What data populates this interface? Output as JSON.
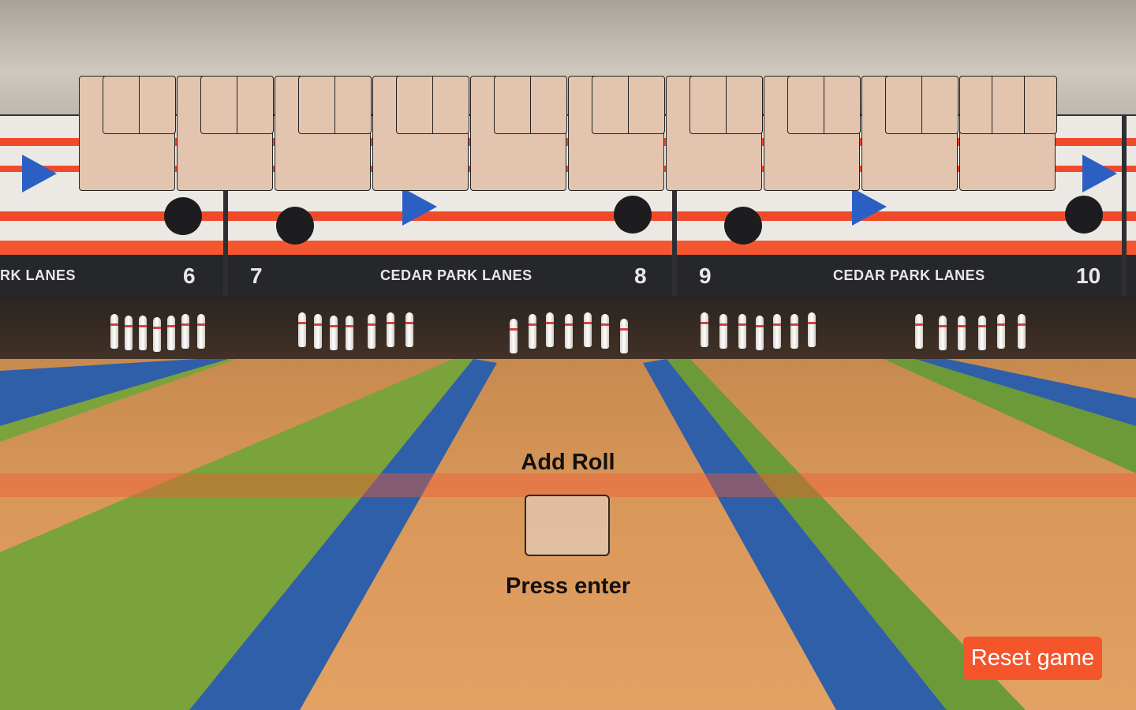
{
  "background": {
    "sign_left_partial": "RK LANES",
    "sign_center": "CEDAR PARK LANES",
    "sign_right": "CEDAR PARK LANES",
    "lane_numbers": [
      "6",
      "7",
      "8",
      "9",
      "10"
    ]
  },
  "scoreboard": {
    "frames": [
      {
        "roll1": "",
        "roll2": "",
        "score": ""
      },
      {
        "roll1": "",
        "roll2": "",
        "score": ""
      },
      {
        "roll1": "",
        "roll2": "",
        "score": ""
      },
      {
        "roll1": "",
        "roll2": "",
        "score": ""
      },
      {
        "roll1": "",
        "roll2": "",
        "score": ""
      },
      {
        "roll1": "",
        "roll2": "",
        "score": ""
      },
      {
        "roll1": "",
        "roll2": "",
        "score": ""
      },
      {
        "roll1": "",
        "roll2": "",
        "score": ""
      },
      {
        "roll1": "",
        "roll2": "",
        "score": ""
      },
      {
        "roll1": "",
        "roll2": "",
        "roll3": "",
        "score": ""
      }
    ]
  },
  "roll_entry": {
    "label": "Add Roll",
    "value": "",
    "hint": "Press enter"
  },
  "controls": {
    "reset_label": "Reset game"
  },
  "colors": {
    "frame_fill": "#e3c4ae",
    "reset_button": "#f4552b"
  }
}
